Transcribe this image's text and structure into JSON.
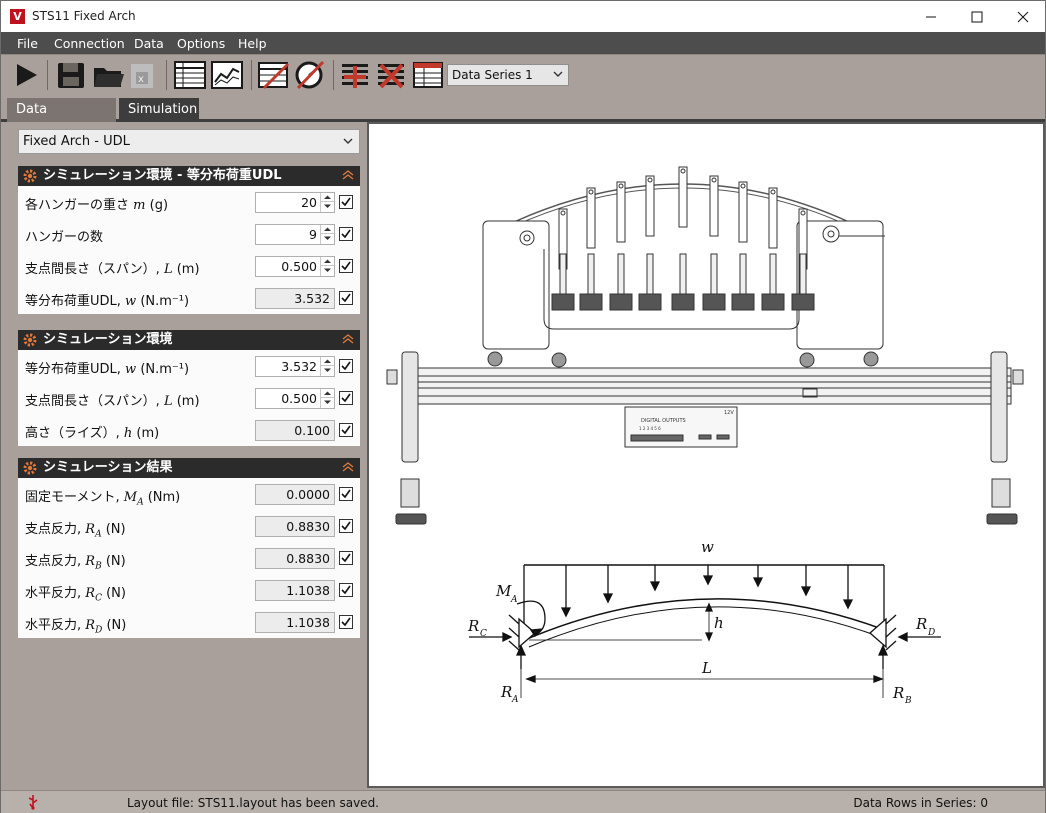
{
  "window": {
    "title": "STS11 Fixed Arch",
    "icon_letter": "V"
  },
  "menu": {
    "file": "File",
    "connection": "Connection",
    "data": "Data",
    "options": "Options",
    "help": "Help"
  },
  "toolbar": {
    "series_select": "Data Series 1"
  },
  "tabs": {
    "acquisition": "Data Aquisition",
    "simulation": "Simulation"
  },
  "experiment_select": "Fixed Arch - UDL",
  "sections": [
    {
      "title": "シミュレーション環境 - 等分布荷重UDL",
      "rows": [
        {
          "label": "各ハンガーの重さ",
          "symbol": "m",
          "unit": "(g)",
          "value": "20",
          "editable": true
        },
        {
          "label": "ハンガーの数",
          "symbol": "",
          "unit": "",
          "value": "9",
          "editable": true
        },
        {
          "label": "支点間長さ（スパン）,",
          "symbol": "L",
          "unit": "(m)",
          "value": "0.500",
          "editable": true
        },
        {
          "label": "等分布荷重UDL,",
          "symbol": "w",
          "unit": "(N.m⁻¹)",
          "value": "3.532",
          "editable": false
        }
      ]
    },
    {
      "title": "シミュレーション環境",
      "rows": [
        {
          "label": "等分布荷重UDL,",
          "symbol": "w",
          "unit": "(N.m⁻¹)",
          "value": "3.532",
          "editable": true
        },
        {
          "label": "支点間長さ（スパン）,",
          "symbol": "L",
          "unit": "(m)",
          "value": "0.500",
          "editable": true
        },
        {
          "label": "高さ（ライズ）,",
          "symbol": "h",
          "unit": "(m)",
          "value": "0.100",
          "editable": false
        }
      ]
    },
    {
      "title": "シミュレーション結果",
      "rows": [
        {
          "label": "固定モーメント,",
          "symbol": "MA",
          "unit": "(Nm)",
          "value": "0.0000",
          "editable": false
        },
        {
          "label": "支点反力,",
          "symbol": "RA",
          "unit": "(N)",
          "value": "0.8830",
          "editable": false
        },
        {
          "label": "支点反力,",
          "symbol": "RB",
          "unit": "(N)",
          "value": "0.8830",
          "editable": false
        },
        {
          "label": "水平反力,",
          "symbol": "RC",
          "unit": "(N)",
          "value": "1.1038",
          "editable": false
        },
        {
          "label": "水平反力,",
          "symbol": "RD",
          "unit": "(N)",
          "value": "1.1038",
          "editable": false
        }
      ]
    }
  ],
  "diagram_labels": {
    "w": "w",
    "MA": "M",
    "MA_sub": "A",
    "RC": "R",
    "RC_sub": "C",
    "RD": "R",
    "RD_sub": "D",
    "h": "h",
    "L": "L",
    "RA": "R",
    "RA_sub": "A",
    "RB": "R",
    "RB_sub": "B",
    "module_text": "DIGITAL OUTPUTS",
    "module_small": "12V",
    "module_nums": "1 2 3 4 5 6"
  },
  "status": {
    "left": "Layout file: STS11.layout has been saved.",
    "right": "Data Rows in Series: 0"
  },
  "colors": {
    "accent": "#c0111f",
    "section_header": "#2b2b2b",
    "menubar": "#4d4d4d"
  }
}
